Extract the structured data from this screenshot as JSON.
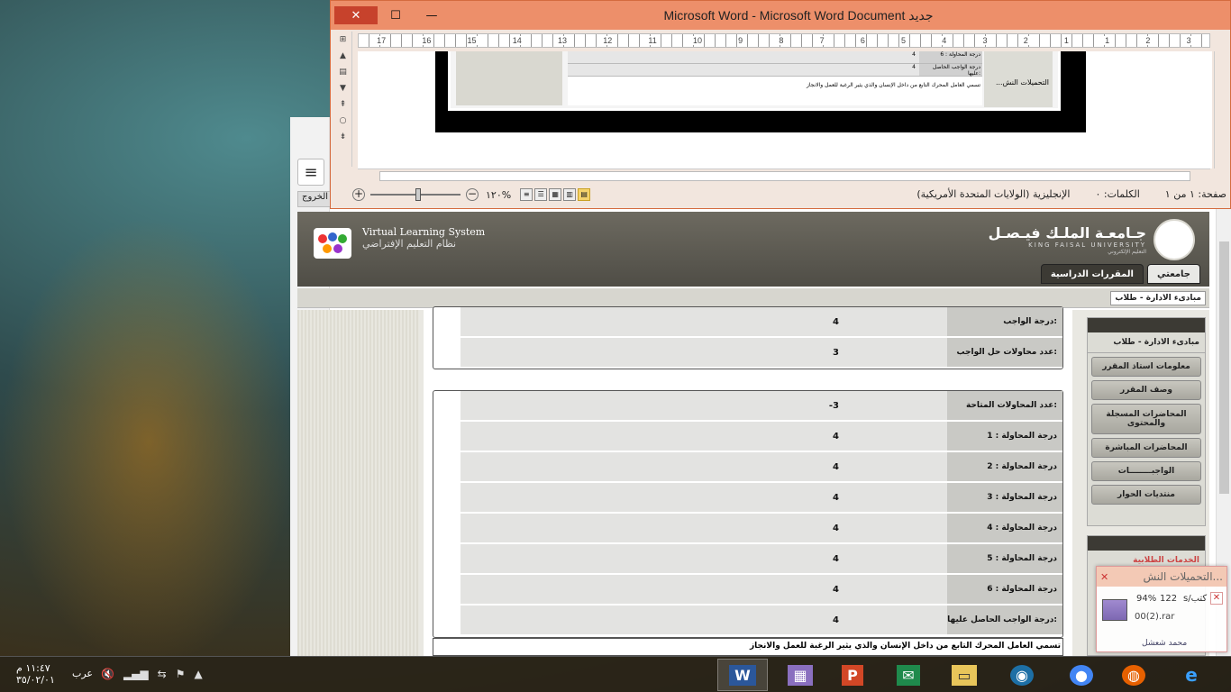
{
  "word": {
    "title": "Microsoft Word - Microsoft Word Document جديد",
    "ruler_numbers": [
      "17",
      "16",
      "15",
      "14",
      "13",
      "12",
      "11",
      "10",
      "9",
      "8",
      "7",
      "6",
      "5",
      "4",
      "3",
      "2",
      "1",
      "1",
      "2",
      "3"
    ],
    "status": {
      "page": "صفحة: ١ من ١",
      "words": "الكلمات: ٠",
      "language": "الإنجليزية (الولايات المتحدة الأمريكية)",
      "zoom": "١٢٠%"
    },
    "doc_preview": {
      "rows": [
        {
          "label": "درجة المحاولة : 6",
          "value": "4"
        },
        {
          "label": "درجة الواجب الحاصل عليها:",
          "value": "4"
        }
      ],
      "caption": "تسمي العامل المحرك التابع من داخل الإنسان والذي يثير الرغبة للعمل والانجاز",
      "side_text": "...التحميلات النش"
    }
  },
  "browser": {
    "logout_label": "الخروج",
    "vls_title": "Virtual Learning System",
    "vls_subtitle": "نظام التعليم الإفتراضي",
    "uni_name_ar": "جـامعـة الملـك فيـصـل",
    "uni_name_en": "KING FAISAL UNIVERSITY",
    "uni_sub": "التعليم الإلكتروني",
    "tabs": [
      "جامعتي",
      "المقررات الدراسية"
    ],
    "breadcrumb": "مبادىء الادارة - طلاب",
    "homework_box": [
      {
        "label": "درجة الواجب:",
        "value": "4"
      },
      {
        "label": "عدد محاولات حل الواجب:",
        "value": "3"
      }
    ],
    "attempts_box": [
      {
        "label": "عدد المحاولات المتاحة:",
        "value": "-3"
      },
      {
        "label": "درجة المحاولة : 1",
        "value": "4"
      },
      {
        "label": "درجة المحاولة : 2",
        "value": "4"
      },
      {
        "label": "درجة المحاولة : 3",
        "value": "4"
      },
      {
        "label": "درجة المحاولة : 4",
        "value": "4"
      },
      {
        "label": "درجة المحاولة : 5",
        "value": "4"
      },
      {
        "label": "درجة المحاولة : 6",
        "value": "4"
      },
      {
        "label": "درجة الواجب الحاصل عليها:",
        "value": "4"
      }
    ],
    "question_text": "تسمي العامل المحرك التابع من داخل الإنسان والذي يثير الرغبة للعمل والانجاز",
    "side_menu": {
      "title": "مبادىء الادارة - طلاب",
      "items": [
        "معلومات استاذ المقرر",
        "وصف المقرر",
        "المحاضرات المسجلة والمحتوى",
        "المحاضرات المباشرة",
        "الواجبــــــــات",
        "منتديات الحوار"
      ]
    },
    "services_title": "الخدمات الطلابية"
  },
  "download": {
    "header": "...التحميلات النش",
    "percent": "94%",
    "size": "122",
    "size_suffix": "s/كتب",
    "filename": "00(2).rar",
    "footer": "محمد شعشل"
  },
  "taskbar": {
    "time": "١١:٤٧ م",
    "date": "٣٥/٠٢/٠١",
    "lang": "عرب"
  }
}
